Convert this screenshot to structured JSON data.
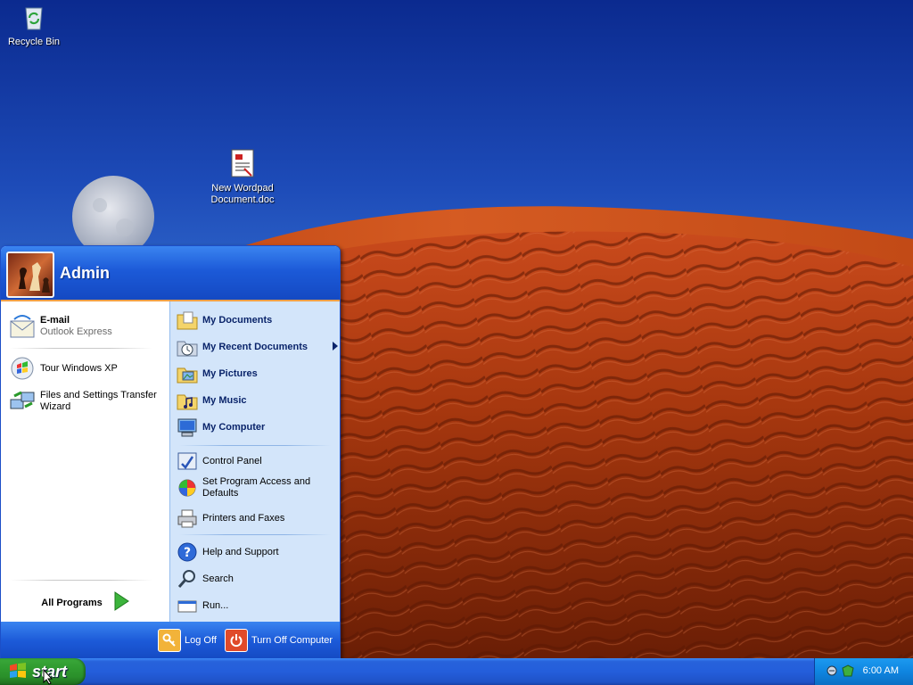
{
  "desktop": {
    "icons": [
      {
        "label": "Recycle Bin",
        "icon": "recycle-bin-icon"
      },
      {
        "label": "New Wordpad Document.doc",
        "line1": "New Wordpad",
        "line2": "Document.doc",
        "icon": "wordpad-document-icon"
      }
    ]
  },
  "start_menu": {
    "user": "Admin",
    "left": {
      "pinned": [
        {
          "label": "E-mail",
          "sub": "Outlook Express",
          "icon": "email-envelope-icon"
        }
      ],
      "recent": [
        {
          "label": "Tour Windows XP",
          "icon": "tour-windows-icon"
        },
        {
          "label_line1": "Files and Settings Transfer",
          "label_line2": "Wizard",
          "icon": "transfer-wizard-icon"
        }
      ],
      "all_programs": "All Programs"
    },
    "right": {
      "places": [
        {
          "label": "My Documents",
          "icon": "folder-documents-icon"
        },
        {
          "label": "My Recent Documents",
          "icon": "recent-documents-icon",
          "submenu": true
        },
        {
          "label": "My Pictures",
          "icon": "folder-pictures-icon"
        },
        {
          "label": "My Music",
          "icon": "folder-music-icon"
        },
        {
          "label": "My Computer",
          "icon": "computer-icon"
        }
      ],
      "settings": [
        {
          "label": "Control Panel",
          "icon": "control-panel-icon"
        },
        {
          "label_line1": "Set Program Access and",
          "label_line2": "Defaults",
          "icon": "program-access-icon"
        },
        {
          "label": "Printers and Faxes",
          "icon": "printer-icon"
        }
      ],
      "tools": [
        {
          "label": "Help and Support",
          "icon": "help-icon"
        },
        {
          "label": "Search",
          "icon": "search-icon"
        },
        {
          "label": "Run...",
          "icon": "run-icon"
        }
      ]
    },
    "footer": {
      "log_off": "Log Off",
      "turn_off": "Turn Off Computer"
    }
  },
  "taskbar": {
    "start_label": "start",
    "clock": "6:00 AM"
  },
  "colors": {
    "xp_blue": "#245edb",
    "start_green": "#2f9a2f",
    "menu_right_bg": "#d3e5fa",
    "header_orange_line": "#f0a047"
  }
}
